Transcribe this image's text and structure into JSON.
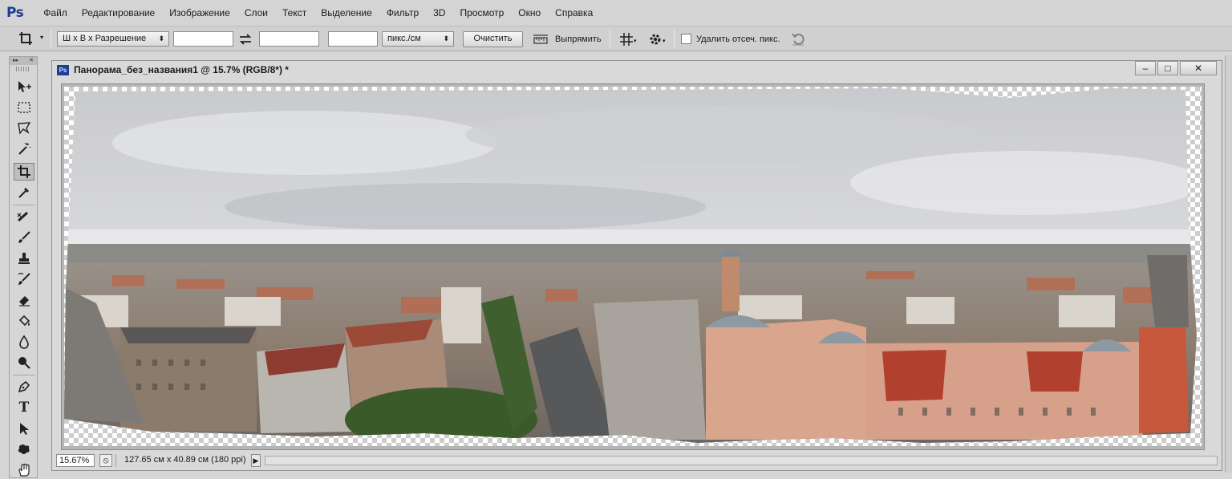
{
  "app": {
    "logo": "Ps"
  },
  "menu": [
    "Файл",
    "Редактирование",
    "Изображение",
    "Слои",
    "Текст",
    "Выделение",
    "Фильтр",
    "3D",
    "Просмотр",
    "Окно",
    "Справка"
  ],
  "options": {
    "tool_icon": "crop-icon",
    "ratio_select": "Ш x В x Разрешение",
    "width_value": "",
    "height_value": "",
    "resolution_value": "",
    "units_select": "пикс./см",
    "clear_button": "Очистить",
    "straighten_label": "Выпрямить",
    "delete_cropped_label": "Удалить отсеч. пикс.",
    "delete_cropped_checked": false
  },
  "tools": [
    "move-icon",
    "marquee-icon",
    "lasso-icon",
    "magic-wand-icon",
    "crop-icon",
    "eyedropper-icon",
    "spot-healing-icon",
    "brush-icon",
    "clone-stamp-icon",
    "history-brush-icon",
    "eraser-icon",
    "paint-bucket-icon",
    "blur-icon",
    "dodge-icon",
    "pen-icon",
    "type-icon",
    "path-selection-icon",
    "shape-icon",
    "hand-icon"
  ],
  "document": {
    "title": "Панорама_без_названия1 @ 15.7% (RGB/8*) *",
    "minimize": "–",
    "maximize": "□",
    "close": "✕"
  },
  "status": {
    "zoom": "15.67%",
    "doc_info": "127.65 см x 40.89 см (180 ppi)"
  }
}
